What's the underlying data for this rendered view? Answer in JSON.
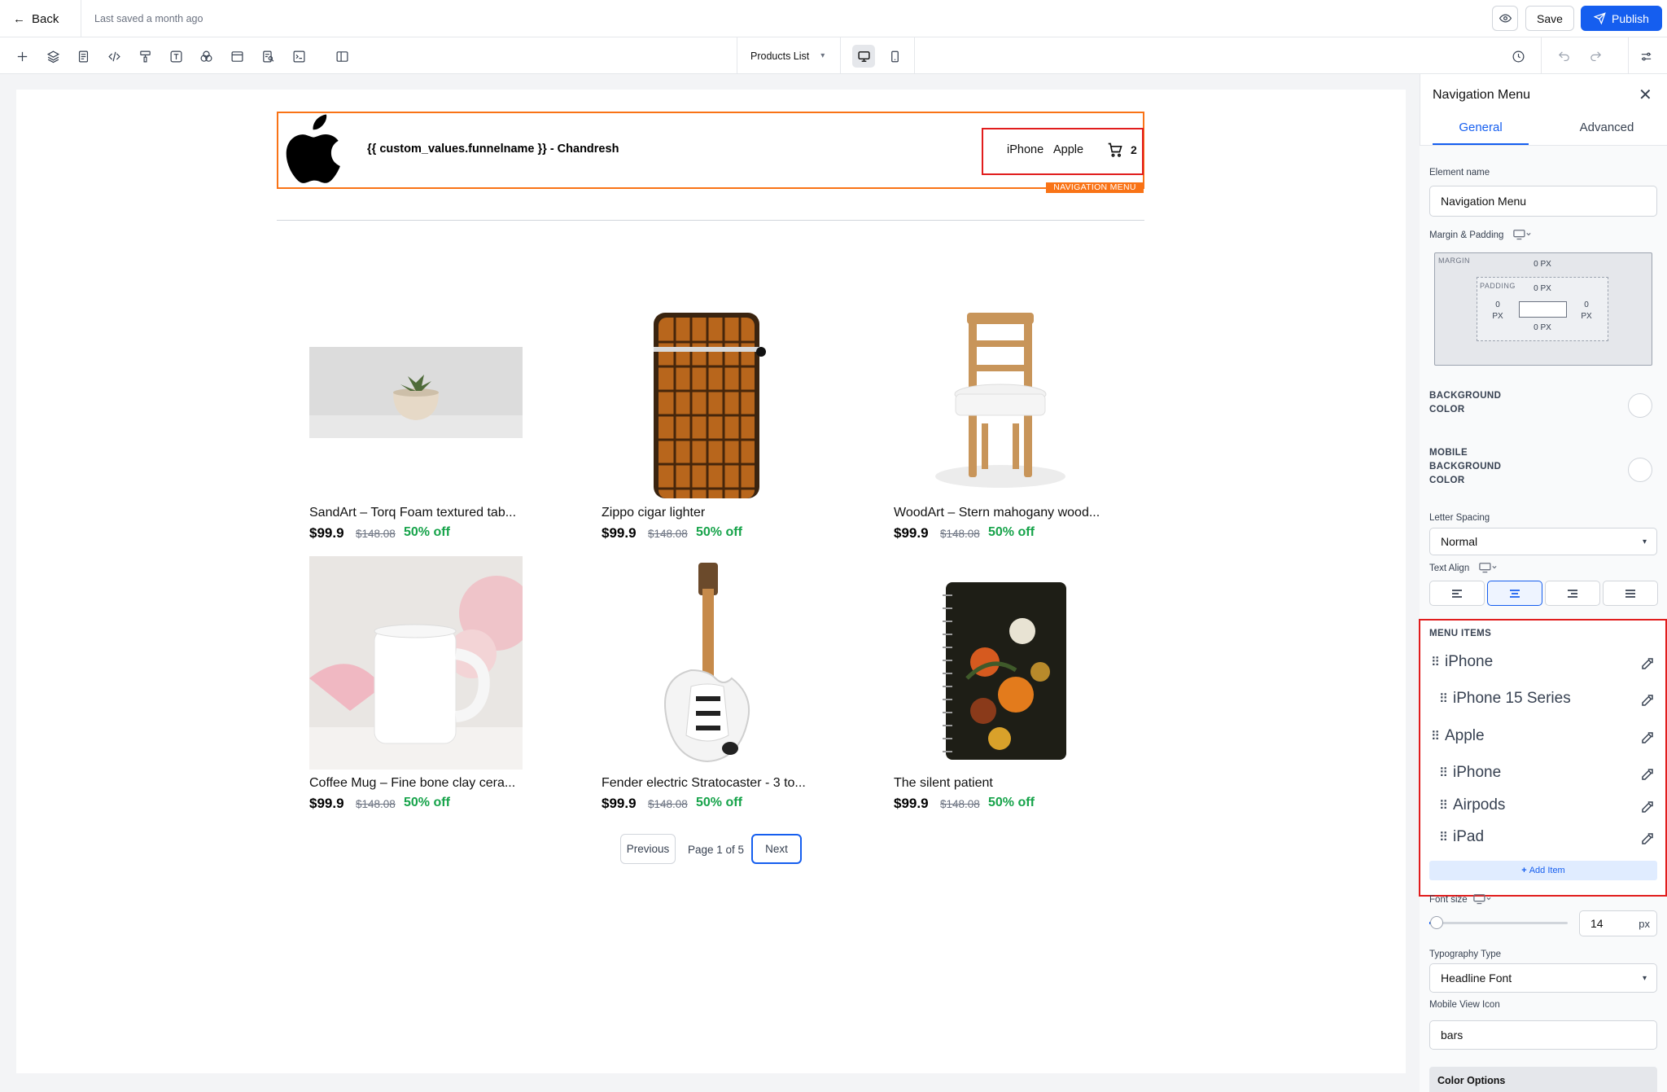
{
  "topbar": {
    "back_label": "Back",
    "last_saved": "Last saved a month ago",
    "save_label": "Save",
    "publish_label": "Publish"
  },
  "toolbar": {
    "icons": [
      "plus-icon",
      "layers-icon",
      "page-icon",
      "code-icon",
      "paint-roller-icon",
      "text-icon",
      "shapes-icon",
      "browser-window-icon",
      "seo-icon",
      "terminal-icon",
      "split-view-icon"
    ],
    "page_selector": "Products List",
    "device": "desktop",
    "right_icons": [
      "history-icon",
      "undo-icon",
      "redo-icon",
      "settings-icon"
    ]
  },
  "canvas": {
    "header": {
      "funnel_name": "{{ custom_values.funnelname }} - Chandresh",
      "nav_items": [
        "iPhone",
        "Apple"
      ],
      "cart_count": "2",
      "selection_tag": "NAVIGATION MENU"
    },
    "products": [
      {
        "title": "SandArt – Torq Foam textured tab...",
        "price": "$99.9",
        "old_price": "$148.08",
        "discount": "50% off",
        "image": "succulent-pot"
      },
      {
        "title": "Zippo cigar lighter",
        "price": "$99.9",
        "old_price": "$148.08",
        "discount": "50% off",
        "image": "croc-lighter"
      },
      {
        "title": "WoodArt – Stern mahogany wood...",
        "price": "$99.9",
        "old_price": "$148.08",
        "discount": "50% off",
        "image": "wooden-chair"
      },
      {
        "title": "Coffee Mug – Fine bone clay cera...",
        "price": "$99.9",
        "old_price": "$148.08",
        "discount": "50% off",
        "image": "white-mug"
      },
      {
        "title": "Fender electric Stratocaster - 3 to...",
        "price": "$99.9",
        "old_price": "$148.08",
        "discount": "50% off",
        "image": "white-guitar"
      },
      {
        "title": "The silent patient",
        "price": "$99.9",
        "old_price": "$148.08",
        "discount": "50% off",
        "image": "floral-notebook"
      }
    ],
    "pagination": {
      "previous": "Previous",
      "info": "Page 1 of 5",
      "next": "Next"
    }
  },
  "panel": {
    "title": "Navigation Menu",
    "tabs": [
      "General",
      "Advanced"
    ],
    "active_tab": "General",
    "element_name_label": "Element name",
    "element_name_value": "Navigation Menu",
    "margin_padding_label": "Margin & Padding",
    "margin_label": "MARGIN",
    "padding_label": "PADDING",
    "margin_top": "0 PX",
    "padding_top": "0 PX",
    "padding_bottom": "0 PX",
    "padding_left": "0",
    "padding_right": "0",
    "px": "PX",
    "bg_color_label_1": "BACKGROUND",
    "bg_color_label_2": "COLOR",
    "mobile_bg_label_1": "MOBILE",
    "mobile_bg_label_2": "BACKGROUND",
    "mobile_bg_label_3": "COLOR",
    "letter_spacing_label": "Letter Spacing",
    "letter_spacing_value": "Normal",
    "text_align_label": "Text Align",
    "text_align_active": "center",
    "menu_items_label": "MENU ITEMS",
    "menu_items": [
      {
        "label": "iPhone",
        "level": 0
      },
      {
        "label": "iPhone 15 Series",
        "level": 1
      },
      {
        "label": "Apple",
        "level": 0
      },
      {
        "label": "iPhone",
        "level": 1
      },
      {
        "label": "Airpods",
        "level": 1
      },
      {
        "label": "iPad",
        "level": 1
      }
    ],
    "add_item_label": "Add Item",
    "font_size_label": "Font size",
    "font_size_value": "14",
    "font_size_unit": "px",
    "typography_label": "Typography Type",
    "typography_value": "Headline Font",
    "mobile_icon_label": "Mobile View Icon",
    "mobile_icon_value": "bars",
    "color_options_label": "Color Options"
  },
  "colors": {
    "accent": "#155eef",
    "selection": "#f97316",
    "highlight": "#e11d1d",
    "discount": "#16a34a"
  }
}
